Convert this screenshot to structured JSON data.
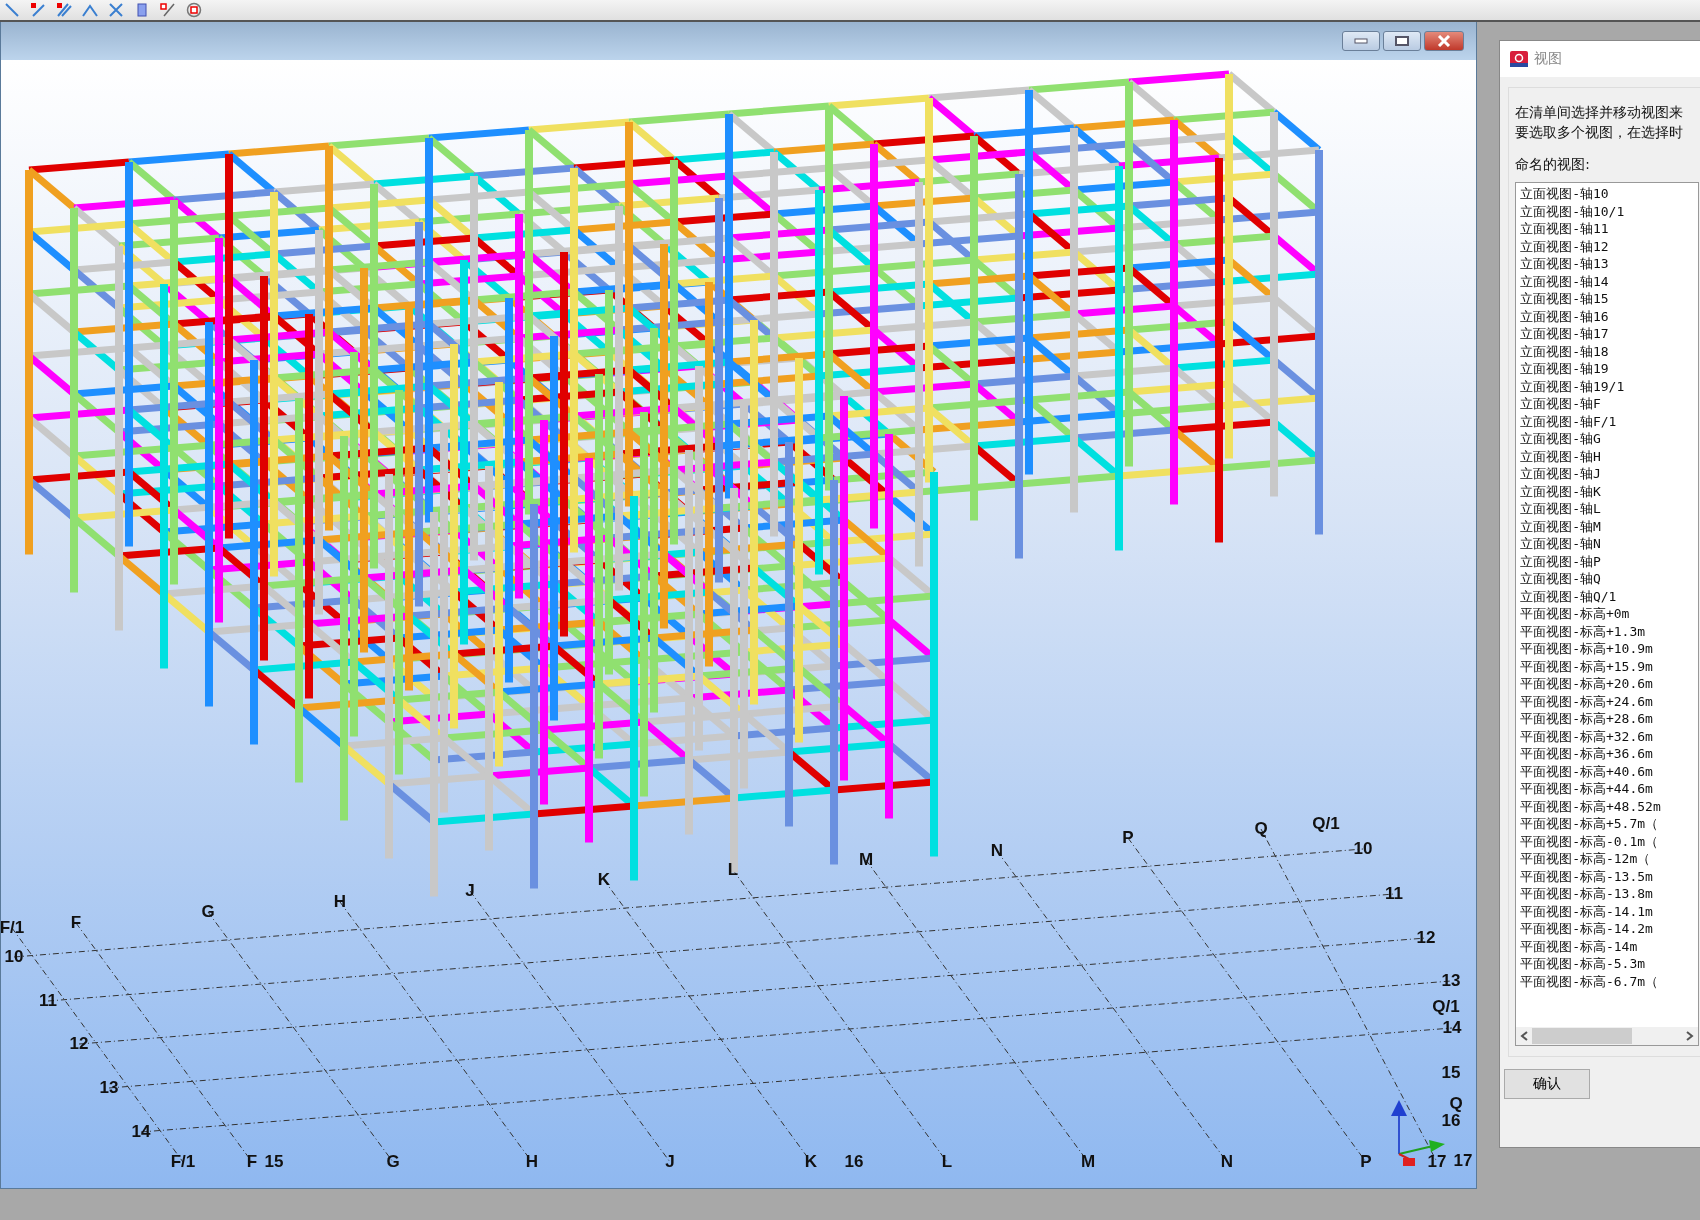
{
  "viewport": {
    "grid_labels": [
      "Q/1",
      "Q",
      "P",
      "N",
      "M",
      "L",
      "K",
      "J",
      "H",
      "G",
      "F",
      "F/1",
      "10",
      "11",
      "12",
      "13",
      "Q/1",
      "14",
      "15",
      "Q",
      "16",
      "17",
      "10",
      "11",
      "12",
      "13",
      "14",
      "F/1",
      "F",
      "15",
      "G",
      "H",
      "J",
      "K",
      "16",
      "L",
      "M",
      "N",
      "P",
      "17"
    ]
  },
  "dialog": {
    "title": "视图",
    "instructions": [
      "在清单间选择并移动视图来",
      "要选取多个视图，在选择时"
    ],
    "list_label": "命名的视图:",
    "views": [
      "立面视图-轴10",
      "立面视图-轴10/1",
      "立面视图-轴11",
      "立面视图-轴12",
      "立面视图-轴13",
      "立面视图-轴14",
      "立面视图-轴15",
      "立面视图-轴16",
      "立面视图-轴17",
      "立面视图-轴18",
      "立面视图-轴19",
      "立面视图-轴19/1",
      "立面视图-轴F",
      "立面视图-轴F/1",
      "立面视图-轴G",
      "立面视图-轴H",
      "立面视图-轴J",
      "立面视图-轴K",
      "立面视图-轴L",
      "立面视图-轴M",
      "立面视图-轴N",
      "立面视图-轴P",
      "立面视图-轴Q",
      "立面视图-轴Q/1",
      "平面视图-标高+0m",
      "平面视图-标高+1.3m",
      "平面视图-标高+10.9m",
      "平面视图-标高+15.9m",
      "平面视图-标高+20.6m",
      "平面视图-标高+24.6m",
      "平面视图-标高+28.6m",
      "平面视图-标高+32.6m",
      "平面视图-标高+36.6m",
      "平面视图-标高+40.6m",
      "平面视图-标高+44.6m",
      "平面视图-标高+48.52m",
      "平面视图-标高+5.7m（",
      "平面视图-标高-0.1m（",
      "平面视图-标高-12m（",
      "平面视图-标高-13.5m",
      "平面视图-标高-13.8m",
      "平面视图-标高-14.1m",
      "平面视图-标高-14.2m",
      "平面视图-标高-14m",
      "平面视图-标高-5.3m",
      "平面视图-标高-6.7m（"
    ],
    "confirm_button": "确认"
  }
}
